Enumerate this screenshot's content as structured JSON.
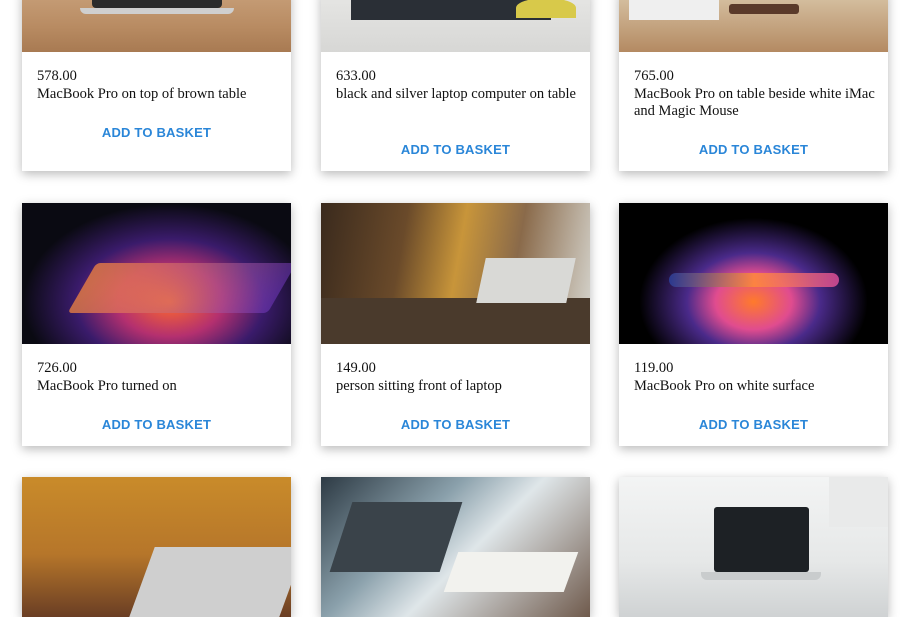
{
  "products": [
    {
      "price": "578.00",
      "title": "MacBook Pro on top of brown table",
      "button": "ADD TO BASKET"
    },
    {
      "price": "633.00",
      "title": "black and silver laptop computer on table",
      "button": "ADD TO BASKET"
    },
    {
      "price": "765.00",
      "title": "MacBook Pro on table beside white iMac and Magic Mouse",
      "button": "ADD TO BASKET"
    },
    {
      "price": "726.00",
      "title": "MacBook Pro turned on",
      "button": "ADD TO BASKET"
    },
    {
      "price": "149.00",
      "title": "person sitting front of laptop",
      "button": "ADD TO BASKET"
    },
    {
      "price": "119.00",
      "title": "MacBook Pro on white surface",
      "button": "ADD TO BASKET"
    }
  ],
  "colors": {
    "button": "#2a86d8",
    "text": "#111111",
    "background": "#ffffff"
  }
}
